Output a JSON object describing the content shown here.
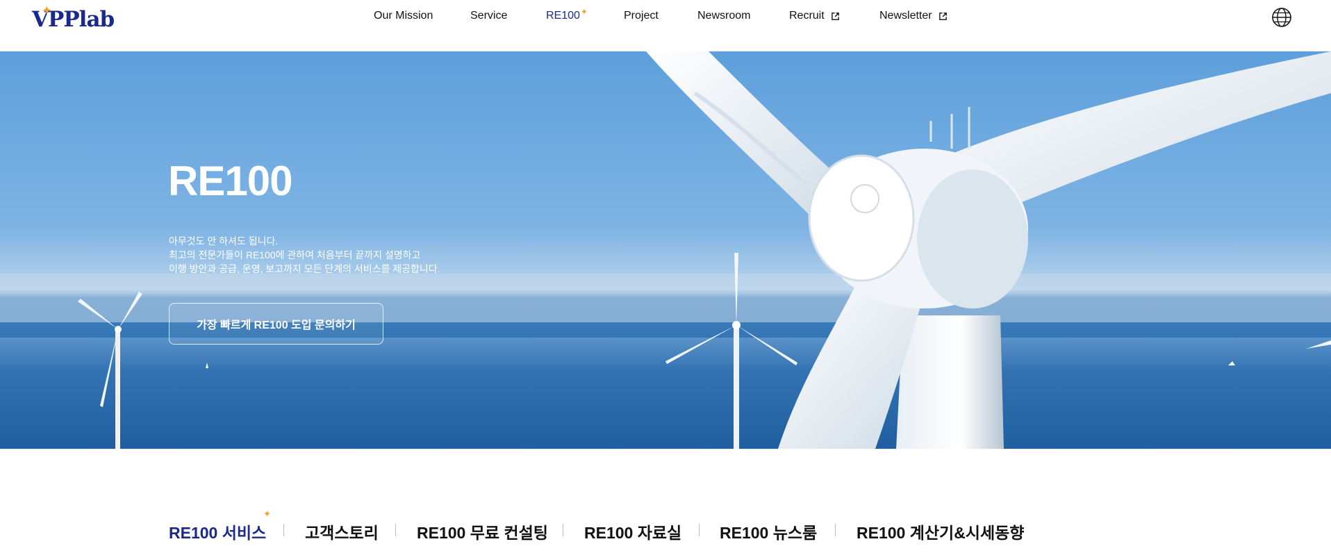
{
  "header": {
    "logo_text": "VPPlab",
    "nav": [
      {
        "label": "Our Mission"
      },
      {
        "label": "Service"
      },
      {
        "label": "RE100"
      },
      {
        "label": "Project"
      },
      {
        "label": "Newsroom"
      },
      {
        "label": "Recruit"
      },
      {
        "label": "Newsletter"
      }
    ],
    "active_nav": "RE100",
    "language_icon": "globe-icon"
  },
  "hero": {
    "title": "RE100",
    "description": [
      "아무것도 안 하셔도 됩니다.",
      "최고의 전문가들이 RE100에 관하여 처음부터 끝까지 설명하고",
      "이행 방안과 공급, 운영, 보고까지 모든 단계의 서비스를 제공합니다."
    ],
    "cta_label": "가장 빠르게 RE100 도입 문의하기"
  },
  "subnav": {
    "items": [
      {
        "label": "RE100 서비스"
      },
      {
        "label": "고객스토리"
      },
      {
        "label": "RE100 무료 컨설팅"
      },
      {
        "label": "RE100 자료실"
      },
      {
        "label": "RE100 뉴스룸"
      },
      {
        "label": "RE100 계산기&시세동향"
      }
    ],
    "active_item": "RE100 서비스"
  },
  "colors": {
    "brand_navy": "#1a2a8c",
    "accent_orange": "#f0a21f"
  }
}
